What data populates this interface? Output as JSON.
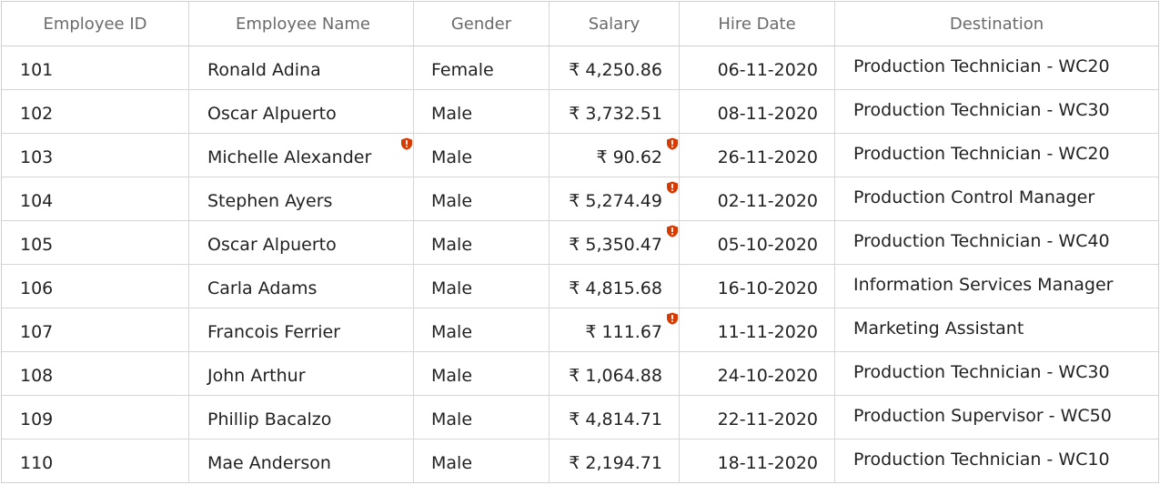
{
  "columns": [
    {
      "key": "id",
      "label": "Employee ID"
    },
    {
      "key": "name",
      "label": "Employee Name"
    },
    {
      "key": "gender",
      "label": "Gender"
    },
    {
      "key": "salary",
      "label": "Salary"
    },
    {
      "key": "hire_date",
      "label": "Hire Date"
    },
    {
      "key": "destination",
      "label": "Destination"
    }
  ],
  "rows": [
    {
      "id": "101",
      "name": "Ronald Adina",
      "gender": "Female",
      "salary": "₹ 4,250.86",
      "hire_date": "06-11-2020",
      "destination": "Production Technician - WC20",
      "name_error": false,
      "salary_error": false
    },
    {
      "id": "102",
      "name": "Oscar Alpuerto",
      "gender": "Male",
      "salary": "₹ 3,732.51",
      "hire_date": "08-11-2020",
      "destination": "Production Technician - WC30",
      "name_error": false,
      "salary_error": false
    },
    {
      "id": "103",
      "name": "Michelle Alexander",
      "gender": "Male",
      "salary": "₹ 90.62",
      "hire_date": "26-11-2020",
      "destination": "Production Technician - WC20",
      "name_error": true,
      "salary_error": true
    },
    {
      "id": "104",
      "name": "Stephen Ayers",
      "gender": "Male",
      "salary": "₹ 5,274.49",
      "hire_date": "02-11-2020",
      "destination": "Production Control Manager",
      "name_error": false,
      "salary_error": true
    },
    {
      "id": "105",
      "name": "Oscar Alpuerto",
      "gender": "Male",
      "salary": "₹ 5,350.47",
      "hire_date": "05-10-2020",
      "destination": "Production Technician - WC40",
      "name_error": false,
      "salary_error": true
    },
    {
      "id": "106",
      "name": "Carla Adams",
      "gender": "Male",
      "salary": "₹ 4,815.68",
      "hire_date": "16-10-2020",
      "destination": "Information Services Manager",
      "name_error": false,
      "salary_error": false
    },
    {
      "id": "107",
      "name": "Francois Ferrier",
      "gender": "Male",
      "salary": "₹ 111.67",
      "hire_date": "11-11-2020",
      "destination": "Marketing Assistant",
      "name_error": false,
      "salary_error": true
    },
    {
      "id": "108",
      "name": "John Arthur",
      "gender": "Male",
      "salary": "₹ 1,064.88",
      "hire_date": "24-10-2020",
      "destination": "Production Technician - WC30",
      "name_error": false,
      "salary_error": false
    },
    {
      "id": "109",
      "name": "Phillip Bacalzo",
      "gender": "Male",
      "salary": "₹ 4,814.71",
      "hire_date": "22-11-2020",
      "destination": "Production Supervisor - WC50",
      "name_error": false,
      "salary_error": false
    },
    {
      "id": "110",
      "name": "Mae Anderson",
      "gender": "Male",
      "salary": "₹ 2,194.71",
      "hire_date": "18-11-2020",
      "destination": "Production Technician - WC10",
      "name_error": false,
      "salary_error": false
    }
  ],
  "icons": {
    "error": "error-shield-icon"
  },
  "colors": {
    "error": "#d83b01",
    "header_text": "#6b6b6b",
    "cell_text": "#222222",
    "gridline": "#d6d6d6"
  }
}
